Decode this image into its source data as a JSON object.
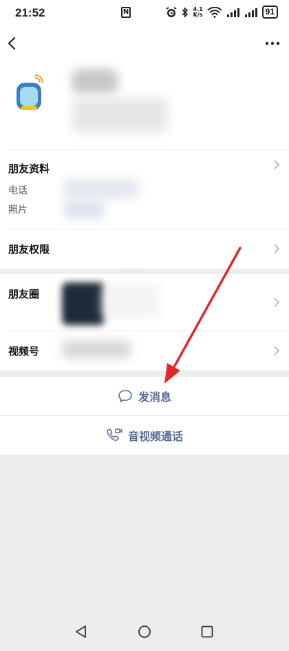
{
  "status_bar": {
    "time": "21:52",
    "nfc_label": "N",
    "net_speed_value": "4.1",
    "net_speed_unit": "K/s",
    "battery": "91"
  },
  "profile": {
    "sections": {
      "friend_info": "朋友资料",
      "phone": "电话",
      "photos": "照片",
      "friend_permissions": "朋友权限",
      "moments": "朋友圈",
      "channels": "视频号"
    }
  },
  "actions": {
    "send_message": "发消息",
    "av_call": "音视频通话"
  },
  "icons": {
    "back": "chevron-left-icon",
    "more": "more-dots-icon",
    "message": "chat-bubble-icon",
    "call": "phone-video-icon"
  },
  "colors": {
    "link_blue": "#576b95",
    "annotation_red": "#e0282a",
    "page_bg": "#ededed"
  }
}
